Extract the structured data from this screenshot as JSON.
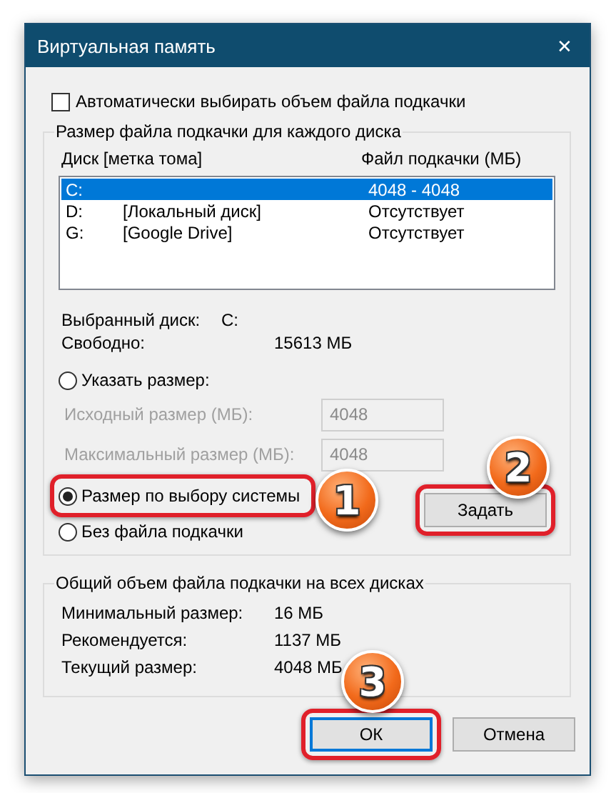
{
  "window": {
    "title": "Виртуальная память",
    "close_icon": "✕"
  },
  "auto_size": {
    "label": "Автоматически выбирать объем файла подкачки",
    "checked": false
  },
  "per_disk": {
    "title": "Размер файла подкачки для каждого диска",
    "columns": [
      "Диск [метка тома]",
      "Файл подкачки (МБ)"
    ],
    "rows": [
      {
        "disk": "C:",
        "volume": "",
        "size": "4048 - 4048",
        "selected": true
      },
      {
        "disk": "D:",
        "volume": "[Локальный диск]",
        "size": "Отсутствует",
        "selected": false
      },
      {
        "disk": "G:",
        "volume": "[Google Drive]",
        "size": "Отсутствует",
        "selected": false
      }
    ],
    "info": [
      {
        "label": "Выбранный диск:",
        "value": "C:"
      },
      {
        "label": "Свободно:",
        "value": "15613 МБ"
      }
    ],
    "options": [
      {
        "kind": "radio",
        "label": "Указать размер:",
        "selected": false,
        "highlighted": false
      },
      {
        "kind": "field",
        "label": "Исходный размер (МБ):",
        "value": "4048",
        "disabled": true
      },
      {
        "kind": "field",
        "label": "Максимальный размер (МБ):",
        "value": "4048",
        "disabled": true
      },
      {
        "kind": "radio",
        "label": "Размер по выбору системы",
        "selected": true,
        "highlighted": true,
        "callout": "1"
      },
      {
        "kind": "radio",
        "label": "Без файла подкачки",
        "selected": false,
        "highlighted": false
      }
    ],
    "set_button": {
      "label": "Задать",
      "highlighted": true,
      "callout": "2"
    }
  },
  "totals": {
    "title": "Общий объем файла подкачки на всех дисках",
    "rows": [
      {
        "label": "Минимальный размер:",
        "value": "16 МБ"
      },
      {
        "label": "Рекомендуется:",
        "value": "1137 МБ"
      },
      {
        "label": "Текущий размер:",
        "value": "4048 МБ"
      }
    ]
  },
  "buttons": [
    {
      "label": "ОК",
      "kind": "default",
      "highlighted": true,
      "callout": "3"
    },
    {
      "label": "Отмена",
      "kind": "normal",
      "highlighted": false
    }
  ]
}
